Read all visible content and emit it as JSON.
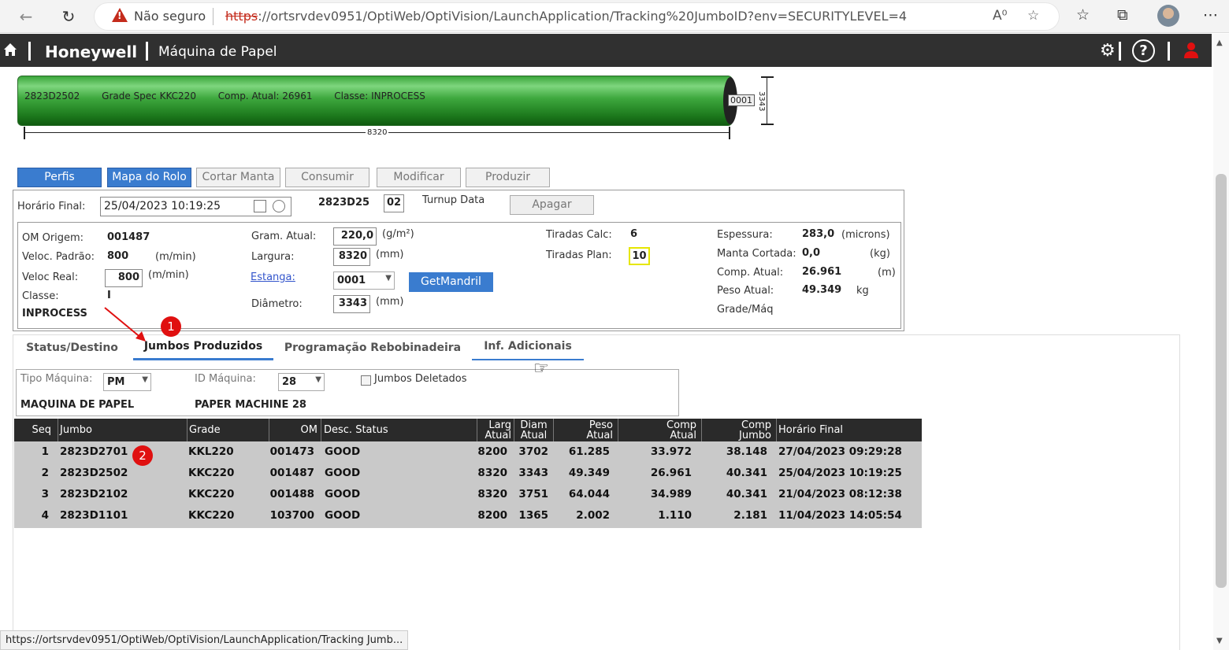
{
  "browser": {
    "not_secure": "Não seguro",
    "url_scheme": "https",
    "url_rest": "://ortsrvdev0951/OptiWeb/OptiVision/LaunchApplication/Tracking%20JumboID?env=SECURITYLEVEL=4",
    "status_url": "https://ortsrvdev0951/OptiWeb/OptiVision/LaunchApplication/Tracking Jumb..."
  },
  "header": {
    "brand": "Honeywell",
    "title": "Máquina de Papel"
  },
  "roll": {
    "id": "2823D2502",
    "grade": "Grade Spec KKC220",
    "comp": "Comp. Atual: 26961",
    "classe": "Classe: INPROCESS",
    "end_label": "0001",
    "width_label": "8320",
    "diameter_label": "3343",
    "color": "#3aa53a"
  },
  "actions": {
    "perfis": "Perfis",
    "mapa": "Mapa do Rolo",
    "cortar": "Cortar Manta",
    "consumir": "Consumir",
    "modificar": "Modificar",
    "produzir": "Produzir"
  },
  "form": {
    "horario_final_label": "Horário Final:",
    "horario_final": "25/04/2023 10:19:25",
    "jumbo_prefix": "2823D25",
    "jumbo_suffix": "02",
    "turnup_label": "Turnup Data",
    "apagar": "Apagar",
    "om_origem_label": "OM Origem:",
    "om_origem": "001487",
    "veloc_padrao_label": "Veloc. Padrão:",
    "veloc_padrao": "800",
    "veloc_padrao_unit": "(m/min)",
    "veloc_real_label": "Veloc Real:",
    "veloc_real": "800",
    "veloc_real_unit": "(m/min)",
    "classe_label": "Classe:",
    "classe_val": "I",
    "classe_status": "INPROCESS",
    "gram_label": "Gram. Atual:",
    "gram": "220,0",
    "gram_unit": "(g/m²)",
    "largura_label": "Largura:",
    "largura": "8320",
    "largura_unit": "(mm)",
    "estanga_label": "Estanga:",
    "estanga": "0001",
    "getmandril": "GetMandril",
    "diametro_label": "Diâmetro:",
    "diametro": "3343",
    "diametro_unit": "(mm)",
    "tiradas_calc_label": "Tiradas Calc:",
    "tiradas_calc": "6",
    "tiradas_plan_label": "Tiradas Plan:",
    "tiradas_plan": "10",
    "espessura_label": "Espessura:",
    "espessura": "283,0",
    "espessura_unit": "(microns)",
    "manta_label": "Manta Cortada:",
    "manta": "0,0",
    "manta_unit": "(kg)",
    "comp_label": "Comp. Atual:",
    "comp": "26.961",
    "comp_unit": "(m)",
    "peso_label": "Peso Atual:",
    "peso": "49.349",
    "peso_unit": "kg",
    "grade_maq_label": "Grade/Máq"
  },
  "tabs": {
    "status": "Status/Destino",
    "jumbos": "Jumbos Produzidos",
    "programacao": "Programação Rebobinadeira",
    "inf": "Inf. Adicionais"
  },
  "filter": {
    "tipo_label": "Tipo Máquina:",
    "tipo": "PM",
    "tipo_desc": "MAQUINA DE PAPEL",
    "id_label": "ID Máquina:",
    "id": "28",
    "id_desc": "PAPER MACHINE 28",
    "deleted_label": "Jumbos Deletados"
  },
  "table": {
    "headers": {
      "seq": "Seq",
      "jumbo": "Jumbo",
      "grade": "Grade",
      "om": "OM",
      "desc": "Desc. Status",
      "larg1": "Larg",
      "larg2": "Atual",
      "diam1": "Diam",
      "diam2": "Atual",
      "peso1": "Peso",
      "peso2": "Atual",
      "comp1": "Comp",
      "comp2": "Atual",
      "compj1": "Comp",
      "compj2": "Jumbo",
      "horario": "Horário Final"
    },
    "rows": [
      {
        "seq": "1",
        "jumbo": "2823D2701",
        "grade": "KKL220",
        "om": "001473",
        "desc": "GOOD",
        "larg": "8200",
        "diam": "3702",
        "peso": "61.285",
        "comp": "33.972",
        "compj": "38.148",
        "horario": "27/04/2023 09:29:28"
      },
      {
        "seq": "2",
        "jumbo": "2823D2502",
        "grade": "KKC220",
        "om": "001487",
        "desc": "GOOD",
        "larg": "8320",
        "diam": "3343",
        "peso": "49.349",
        "comp": "26.961",
        "compj": "40.341",
        "horario": "25/04/2023 10:19:25"
      },
      {
        "seq": "3",
        "jumbo": "2823D2102",
        "grade": "KKC220",
        "om": "001488",
        "desc": "GOOD",
        "larg": "8320",
        "diam": "3751",
        "peso": "64.044",
        "comp": "34.989",
        "compj": "40.341",
        "horario": "21/04/2023 08:12:38"
      },
      {
        "seq": "4",
        "jumbo": "2823D1101",
        "grade": "KKC220",
        "om": "103700",
        "desc": "GOOD",
        "larg": "8200",
        "diam": "1365",
        "peso": "2.002",
        "comp": "1.110",
        "compj": "2.181",
        "horario": "11/04/2023 14:05:54"
      }
    ]
  },
  "annotations": {
    "a1": "1",
    "a2": "2"
  }
}
